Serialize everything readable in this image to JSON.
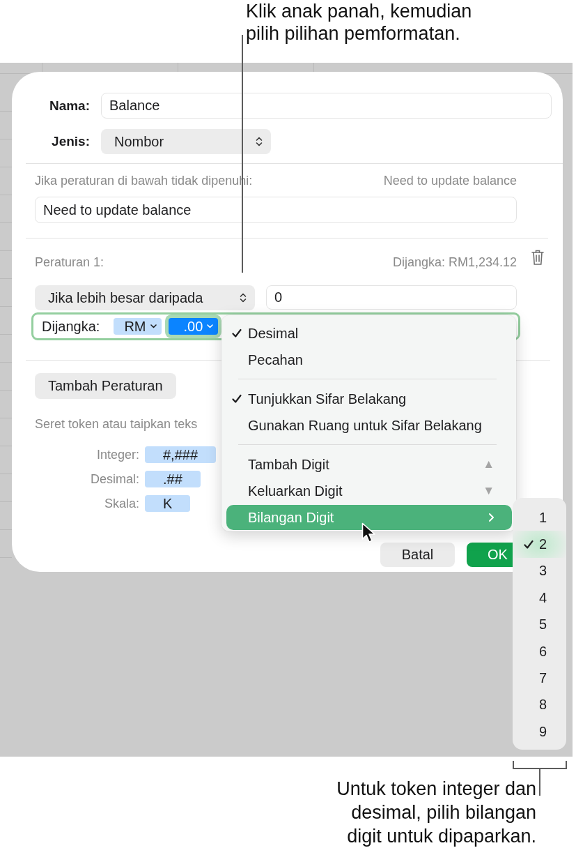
{
  "top_callout": {
    "lines": [
      "Klik anak panah, kemudian",
      "pilih pilihan pemformatan."
    ]
  },
  "dialog": {
    "name": {
      "label": "Nama:",
      "value": "Balance"
    },
    "type": {
      "label": "Jenis:",
      "value": "Nombor"
    },
    "fallback": {
      "label": "Jika peraturan di bawah tidak dipenuhi:",
      "preview": "Need to update balance",
      "value": "Need to update balance"
    },
    "rules": [
      {
        "title": "Peraturan 1:",
        "preview": "Dijangka: RM1,234.12",
        "condition": "Jika lebih besar daripada",
        "value": "0",
        "format": {
          "label": "Dijangka:",
          "tokens": [
            {
              "text": "RM",
              "selected": false
            },
            {
              "text": ".00",
              "selected": true
            }
          ]
        }
      }
    ],
    "add_rule_button": "Tambah Peraturan",
    "token_hint": "Seret token atau taipkan teks",
    "token_rows": [
      {
        "label": "Integer:",
        "token": "#,###"
      },
      {
        "label": "Desimal:",
        "token": ".##"
      },
      {
        "label": "Skala:",
        "token": "K"
      }
    ],
    "buttons": [
      {
        "label": "Batal",
        "kind": "cancel"
      },
      {
        "label": "OK",
        "kind": "confirm"
      }
    ]
  },
  "format_menu": {
    "items": [
      {
        "kind": "option",
        "label": "Desimal",
        "checked": true,
        "highlighted": false
      },
      {
        "kind": "option",
        "label": "Pecahan",
        "checked": false,
        "highlighted": false
      },
      {
        "kind": "separator"
      },
      {
        "kind": "option",
        "label": "Tunjukkan Sifar Belakang",
        "checked": true,
        "highlighted": false
      },
      {
        "kind": "option",
        "label": "Gunakan Ruang untuk Sifar Belakang",
        "checked": false,
        "highlighted": false
      },
      {
        "kind": "separator"
      },
      {
        "kind": "command",
        "label": "Tambah Digit",
        "shortcut": "▲",
        "checked": false,
        "highlighted": false
      },
      {
        "kind": "command",
        "label": "Keluarkan Digit",
        "shortcut": "▼",
        "checked": false,
        "highlighted": false
      },
      {
        "kind": "submenu",
        "label": "Bilangan Digit",
        "checked": false,
        "highlighted": true
      }
    ]
  },
  "digit_submenu": {
    "items": [
      {
        "label": "1",
        "selected": false
      },
      {
        "label": "2",
        "selected": true
      },
      {
        "label": "3",
        "selected": false
      },
      {
        "label": "4",
        "selected": false
      },
      {
        "label": "5",
        "selected": false
      },
      {
        "label": "6",
        "selected": false
      },
      {
        "label": "7",
        "selected": false
      },
      {
        "label": "8",
        "selected": false
      },
      {
        "label": "9",
        "selected": false
      }
    ]
  },
  "bottom_callout": {
    "lines": [
      "Untuk token integer dan",
      "desimal, pilih bilangan",
      "digit untuk dipaparkan."
    ]
  }
}
